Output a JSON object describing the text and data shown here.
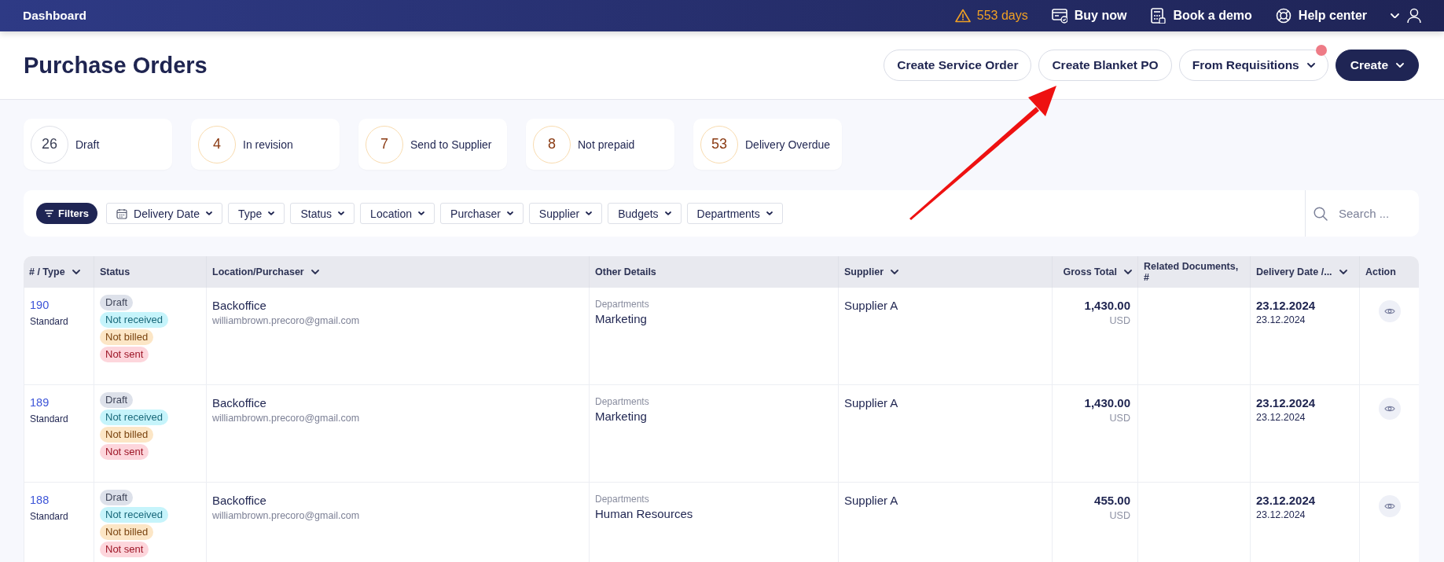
{
  "topbar": {
    "title": "Dashboard",
    "trial": "553 days",
    "links": [
      {
        "label": "Buy now"
      },
      {
        "label": "Book a demo"
      },
      {
        "label": "Help center"
      }
    ]
  },
  "page": {
    "title": "Purchase Orders",
    "actions": [
      {
        "label": "Create Service Order",
        "kind": "outline",
        "dropdown": false,
        "notification": false
      },
      {
        "label": "Create Blanket PO",
        "kind": "outline",
        "dropdown": false,
        "notification": false
      },
      {
        "label": "From Requisitions",
        "kind": "outline",
        "dropdown": true,
        "notification": true
      },
      {
        "label": "Create",
        "kind": "primary",
        "dropdown": true,
        "notification": false
      }
    ]
  },
  "stats": [
    {
      "count": "26",
      "label": "Draft",
      "kind": "neutral"
    },
    {
      "count": "4",
      "label": "In revision",
      "kind": "warning"
    },
    {
      "count": "7",
      "label": "Send to Supplier",
      "kind": "warning"
    },
    {
      "count": "8",
      "label": "Not prepaid",
      "kind": "warning"
    },
    {
      "count": "53",
      "label": "Delivery Overdue",
      "kind": "warning"
    }
  ],
  "filters": {
    "button": "Filters",
    "chips": [
      {
        "label": "Delivery Date",
        "kind": "date"
      },
      {
        "label": "Type",
        "kind": "plain"
      },
      {
        "label": "Status",
        "kind": "plain"
      },
      {
        "label": "Location",
        "kind": "plain"
      },
      {
        "label": "Purchaser",
        "kind": "plain"
      },
      {
        "label": "Supplier",
        "kind": "plain"
      },
      {
        "label": "Budgets",
        "kind": "plain"
      },
      {
        "label": "Departments",
        "kind": "plain"
      }
    ],
    "search": {
      "placeholder": "Search ..."
    }
  },
  "table": {
    "columns": [
      {
        "label": "# / Type",
        "sortable": true
      },
      {
        "label": "Status",
        "sortable": false
      },
      {
        "label": "Location/Purchaser",
        "sortable": true
      },
      {
        "label": "Other Details",
        "sortable": false
      },
      {
        "label": "Supplier",
        "sortable": true
      },
      {
        "label": "Gross Total",
        "sortable": true
      },
      {
        "label": "Related Documents, #",
        "sortable": false
      },
      {
        "label": "Delivery Date /...",
        "sortable": true
      },
      {
        "label": "Action",
        "sortable": false
      }
    ],
    "rows": [
      {
        "number": "190",
        "type": "Standard",
        "statuses": [
          {
            "label": "Draft",
            "kind": "neutral"
          },
          {
            "label": "Not received",
            "kind": "info"
          },
          {
            "label": "Not billed",
            "kind": "warning"
          },
          {
            "label": "Not sent",
            "kind": "danger"
          }
        ],
        "location": "Backoffice",
        "purchaser": "williambrown.precoro@gmail.com",
        "detail_label": "Departments",
        "detail_value": "Marketing",
        "supplier": "Supplier A",
        "total": "1,430.00",
        "currency": "USD",
        "date_main": "23.12.2024",
        "date_sub": "23.12.2024"
      },
      {
        "number": "189",
        "type": "Standard",
        "statuses": [
          {
            "label": "Draft",
            "kind": "neutral"
          },
          {
            "label": "Not received",
            "kind": "info"
          },
          {
            "label": "Not billed",
            "kind": "warning"
          },
          {
            "label": "Not sent",
            "kind": "danger"
          }
        ],
        "location": "Backoffice",
        "purchaser": "williambrown.precoro@gmail.com",
        "detail_label": "Departments",
        "detail_value": "Marketing",
        "supplier": "Supplier A",
        "total": "1,430.00",
        "currency": "USD",
        "date_main": "23.12.2024",
        "date_sub": "23.12.2024"
      },
      {
        "number": "188",
        "type": "Standard",
        "statuses": [
          {
            "label": "Draft",
            "kind": "neutral"
          },
          {
            "label": "Not received",
            "kind": "info"
          },
          {
            "label": "Not billed",
            "kind": "warning"
          },
          {
            "label": "Not sent",
            "kind": "danger"
          }
        ],
        "location": "Backoffice",
        "purchaser": "williambrown.precoro@gmail.com",
        "detail_label": "Departments",
        "detail_value": "Human Resources",
        "supplier": "Supplier A",
        "total": "455.00",
        "currency": "USD",
        "date_main": "23.12.2024",
        "date_sub": "23.12.2024"
      }
    ]
  }
}
